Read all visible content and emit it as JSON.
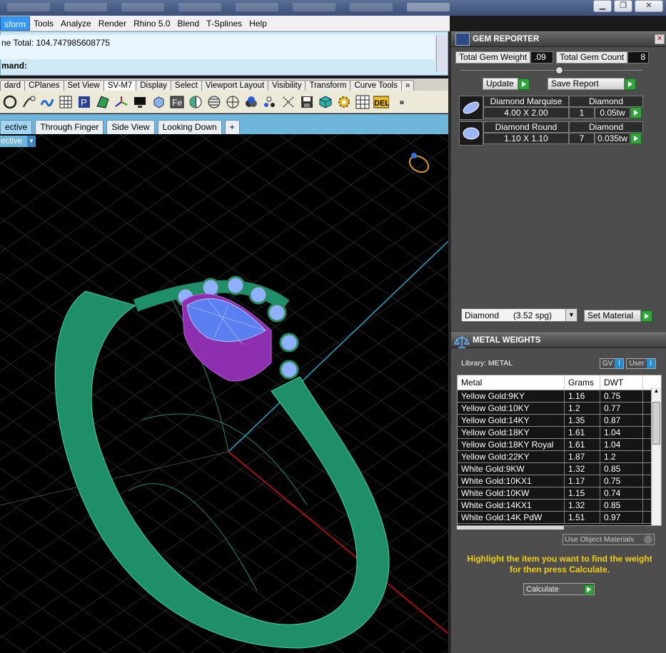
{
  "menubar": {
    "items": [
      "sform",
      "Tools",
      "Analyze",
      "Render",
      "Rhino 5.0",
      "Blend",
      "T-Splines",
      "Help"
    ]
  },
  "command": {
    "history": "ne Total: 104.747985608775",
    "prompt": "mand:"
  },
  "toolbar_tabs": [
    "dard",
    "CPlanes",
    "Set View",
    "SV-M7",
    "Display",
    "Select",
    "Viewport Layout",
    "Visibility",
    "Transform",
    "Curve Tools"
  ],
  "toolbar_more": "»",
  "icons": [
    "circle-icon",
    "pen-curve-icon",
    "snake-icon",
    "grid-select-icon",
    "points-icon",
    "surface-icon",
    "gumball-icon",
    "monitor-icon",
    "box-icon",
    "fe-icon",
    "split-icon",
    "sphere-slice-icon",
    "target-icon",
    "triple-circle-icon",
    "dots-icon",
    "scissor-icon",
    "save-icon",
    "cube-icon",
    "gear-icon",
    "layout-icon",
    "del-icon"
  ],
  "icon_more": "»",
  "viewport_tabs": [
    "ective",
    "Through Finger",
    "Side View",
    "Looking Down",
    "+"
  ],
  "viewport_label": "ective",
  "colors": {
    "ring_green": "#1f8f6a",
    "wire_green": "#3fd9a8",
    "bezel_purple": "#8e2fb0",
    "gem_blue": "#8fb0ff",
    "axis_red": "#d01010",
    "axis_cyan": "#2aa8c8",
    "panel_bg": "#4d4d4d"
  },
  "gem_reporter": {
    "title": "GEM REPORTER",
    "total_weight_label": "Total Gem Weight",
    "total_weight_value": ".09",
    "total_count_label": "Total Gem Count",
    "total_count_value": "8",
    "update_label": "Update",
    "save_report_label": "Save Report",
    "gems": [
      {
        "name": "Diamond Marquise",
        "size": "4.00 X 2.00",
        "material": "Diamond",
        "count": "1",
        "weight": "0.05tw"
      },
      {
        "name": "Diamond Round",
        "size": "1.10 X 1.10",
        "material": "Diamond",
        "count": "7",
        "weight": "0.035tw"
      }
    ],
    "material_select": "Diamond      (3.52 spg)",
    "set_material_label": "Set Material"
  },
  "metal_weights": {
    "title": "METAL WEIGHTS",
    "library_label": "Library:  METAL",
    "gv_label": "GV",
    "user_label": "User",
    "columns": [
      "Metal",
      "Grams",
      "DWT"
    ],
    "rows": [
      [
        "Yellow Gold:9KY",
        "1.16",
        "0.75"
      ],
      [
        "Yellow Gold:10KY",
        "1.2",
        "0.77"
      ],
      [
        "Yellow Gold:14KY",
        "1.35",
        "0.87"
      ],
      [
        "Yellow Gold:18KY",
        "1.61",
        "1.04"
      ],
      [
        "Yellow Gold:18KY Royal",
        "1.61",
        "1.04"
      ],
      [
        "Yellow Gold:22KY",
        "1.87",
        "1.2"
      ],
      [
        "White Gold:9KW",
        "1.32",
        "0.85"
      ],
      [
        "White Gold:10KX1",
        "1.17",
        "0.75"
      ],
      [
        "White Gold:10KW",
        "1.15",
        "0.74"
      ],
      [
        "White Gold:14KX1",
        "1.32",
        "0.85"
      ],
      [
        "White Gold:14K PdW",
        "1.51",
        "0.97"
      ]
    ],
    "use_object_materials": "Use Object Materials",
    "hint": "Highlight the item you want to find the weight for then press Calculate.",
    "calculate_label": "Calculate"
  }
}
